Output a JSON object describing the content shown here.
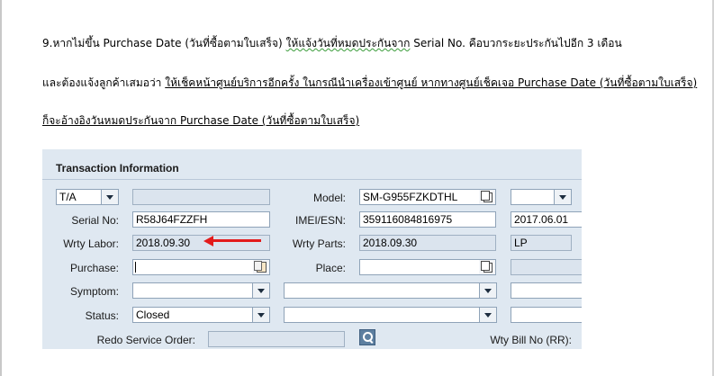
{
  "document": {
    "line1": {
      "prefix": "9.หากไม่ขึ้น Purchase Date (วันที่ซื้อตามใบเสร็จ)",
      "squiggly": "ให้แจ้งวันที่หมดประกันจาก",
      "suffix": "Serial No.  คือบวกระยะประกันไปอีก 3 เดือน"
    },
    "line2": {
      "prefix": "และต้องแจ้งลูกค้าเสมอว่า",
      "underlined": "ให้เช็คหน้าศูนย์บริการอีกครั้ง ในกรณีนำเครื่องเข้าศูนย์ หากทางศูนย์เช็คเจอ Purchase Date (วันที่ซื้อตามใบเสร็จ)"
    },
    "line3": {
      "underlined": "ก็จะอ้างอิงวันหมดประกันจาก Purchase Date (วันที่ซื้อตามใบเสร็จ)"
    }
  },
  "panel": {
    "title": "Transaction Information",
    "type_select": "T/A",
    "labels": {
      "model": "Model:",
      "serial_no": "Serial No:",
      "imei": "IMEI/ESN:",
      "wrty_labor": "Wrty Labor:",
      "wrty_parts": "Wrty Parts:",
      "purchase": "Purchase:",
      "place": "Place:",
      "symptom": "Symptom:",
      "status": "Status:",
      "redo": "Redo Service Order:",
      "wty_bill": "Wty Bill No (RR):"
    },
    "values": {
      "model": "SM-G955FZKDTHL",
      "serial_no": "R58J64FZZFH",
      "imei": "359116084816975",
      "date_right": "2017.06.01",
      "wrty_labor": "2018.09.30",
      "wrty_parts": "2018.09.30",
      "lp": "LP",
      "purchase": "",
      "place": "",
      "symptom": "",
      "status": "Closed",
      "redo": ""
    }
  },
  "colors": {
    "panel_bg": "#dfe8f1",
    "readonly_bg": "#dbe4ee",
    "arrow": "#e31b1b",
    "spellcheck": "#3a9b3a"
  },
  "icons": {
    "model_lookup": "copy-document-icon",
    "purchase_calendar": "calendar-icon",
    "place_lookup": "copy-document-icon",
    "redo_search": "search-icon",
    "annotation": "red-arrow-icon"
  }
}
